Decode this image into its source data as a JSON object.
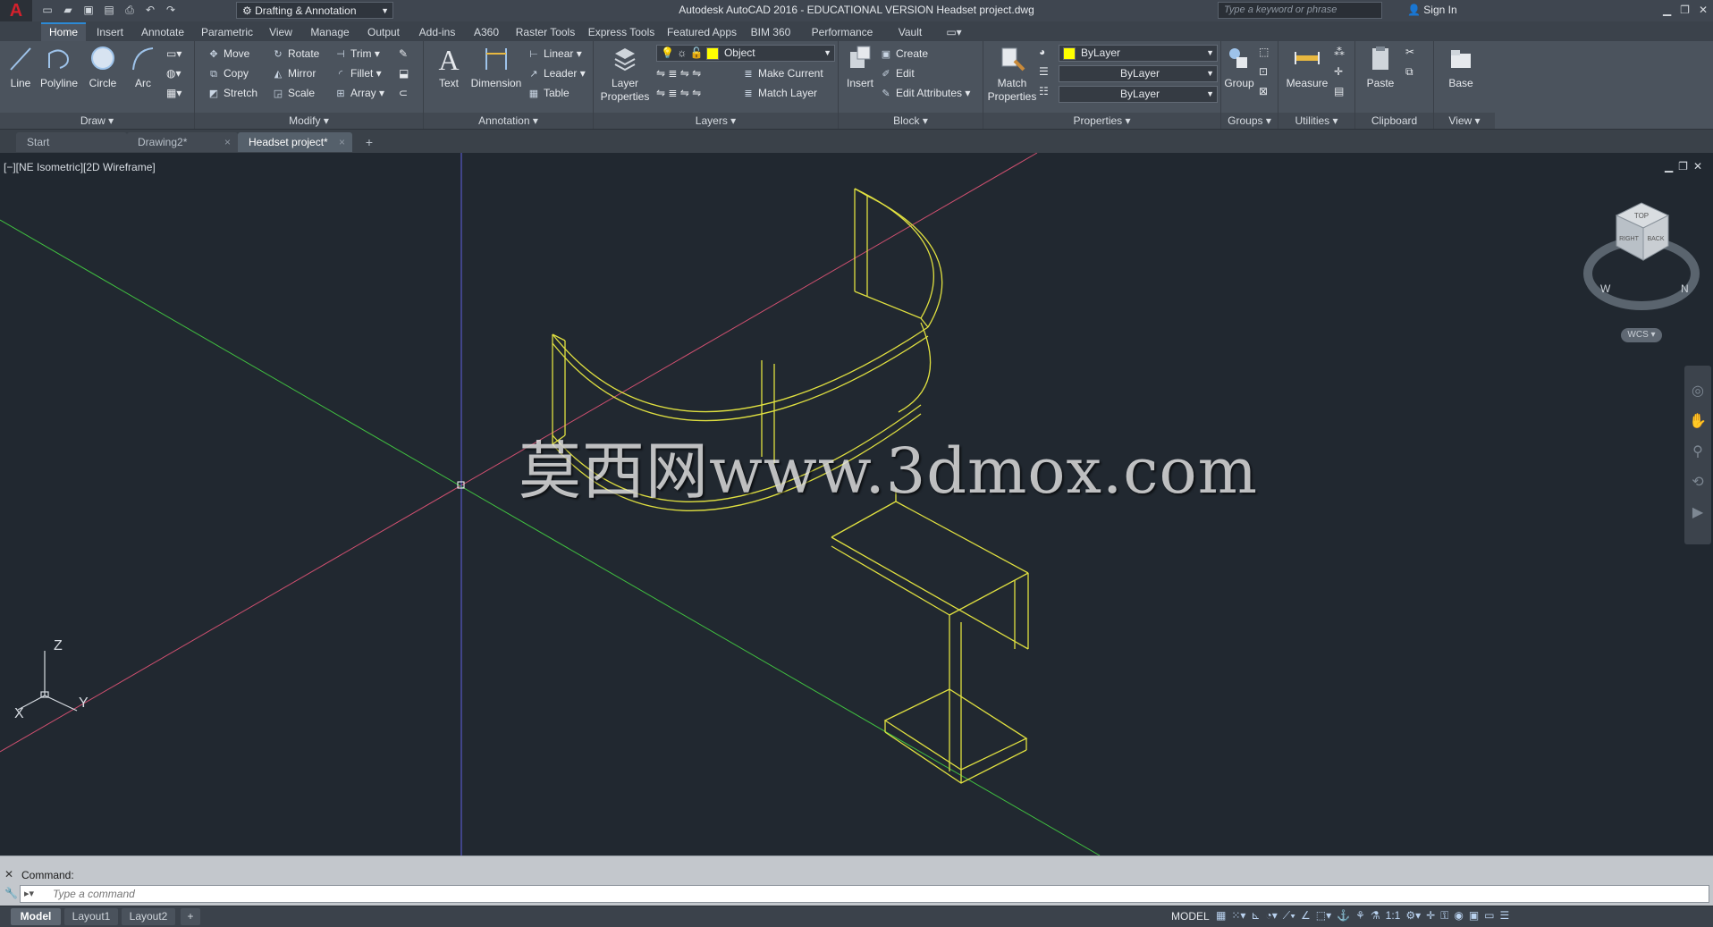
{
  "titlebar": {
    "app_logo": "A",
    "workspace": "Drafting & Annotation",
    "title": "Autodesk AutoCAD 2016 - EDUCATIONAL VERSION    Headset project.dwg",
    "search_placeholder": "Type a keyword or phrase",
    "sign_in": "Sign In"
  },
  "ribbon_tabs": [
    "Home",
    "Insert",
    "Annotate",
    "Parametric",
    "View",
    "Manage",
    "Output",
    "Add-ins",
    "A360",
    "Raster Tools",
    "Express Tools",
    "Featured Apps",
    "BIM 360",
    "Performance",
    "Vault"
  ],
  "draw": {
    "title": "Draw",
    "line": "Line",
    "polyline": "Polyline",
    "circle": "Circle",
    "arc": "Arc"
  },
  "modify": {
    "title": "Modify",
    "move": "Move",
    "rotate": "Rotate",
    "trim": "Trim",
    "copy": "Copy",
    "mirror": "Mirror",
    "fillet": "Fillet",
    "stretch": "Stretch",
    "scale": "Scale",
    "array": "Array"
  },
  "annotation": {
    "title": "Annotation",
    "text": "Text",
    "dimension": "Dimension",
    "linear": "Linear",
    "leader": "Leader",
    "table": "Table"
  },
  "layers": {
    "title": "Layers",
    "layer_properties_1": "Layer",
    "layer_properties_2": "Properties",
    "current_layer": "Object",
    "make_current": "Make Current",
    "match_layer": "Match Layer"
  },
  "block": {
    "title": "Block",
    "insert": "Insert",
    "create": "Create",
    "edit": "Edit",
    "edit_attributes": "Edit Attributes"
  },
  "properties": {
    "title": "Properties",
    "match_1": "Match",
    "match_2": "Properties",
    "color": "ByLayer",
    "linetype": "ByLayer",
    "lineweight": "ByLayer"
  },
  "groups": {
    "title": "Groups",
    "group": "Group"
  },
  "utilities": {
    "title": "Utilities",
    "measure": "Measure"
  },
  "clipboard": {
    "title": "Clipboard",
    "paste": "Paste"
  },
  "view_panel": {
    "title": "View",
    "base": "Base"
  },
  "doc_tabs": [
    "Start",
    "Drawing2*",
    "Headset project*"
  ],
  "viewport": {
    "label": "[−][NE Isometric][2D Wireframe]",
    "watermark": "莫西网www.3dmox.com",
    "wcs": "WCS",
    "axis_z": "Z",
    "axis_x": "X",
    "axis_y": "Y",
    "cube_top": "TOP",
    "cube_right": "RIGHT",
    "cube_back": "BACK",
    "compass_n": "N",
    "compass_w": "W"
  },
  "command": {
    "history": "Command:",
    "placeholder": "Type a command"
  },
  "status": {
    "layout_tabs": [
      "Model",
      "Layout1",
      "Layout2"
    ],
    "model_label": "MODEL",
    "scale": "1:1"
  },
  "colors": {
    "accent": "#2c8ad6",
    "drawing_lines": "#e0e040",
    "x_axis": "#d05070",
    "y_axis": "#40c040",
    "z_axis": "#6060e0",
    "canvas": "#212830"
  }
}
